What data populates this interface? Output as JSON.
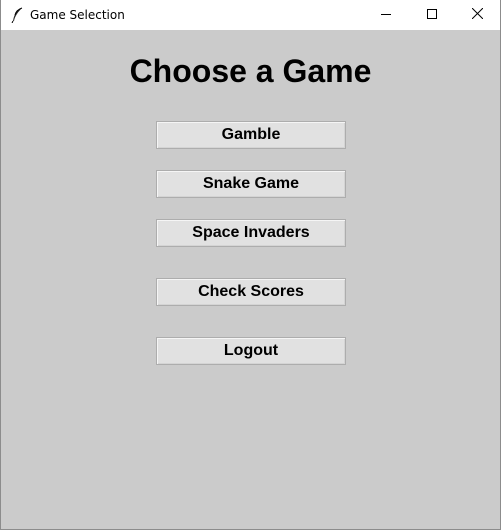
{
  "window": {
    "title": "Game Selection",
    "icon": "feather-icon",
    "controls": [
      "minimize-icon",
      "maximize-icon",
      "close-icon"
    ]
  },
  "main": {
    "heading": "Choose a Game",
    "buttons": [
      {
        "label": "Gamble"
      },
      {
        "label": "Snake Game"
      },
      {
        "label": "Space Invaders"
      },
      {
        "label": "Check Scores"
      },
      {
        "label": "Logout"
      }
    ]
  },
  "colors": {
    "background": "#cbcbcb",
    "button_face": "#e1e1e1",
    "button_border": "#adadad",
    "titlebar": "#ffffff"
  }
}
